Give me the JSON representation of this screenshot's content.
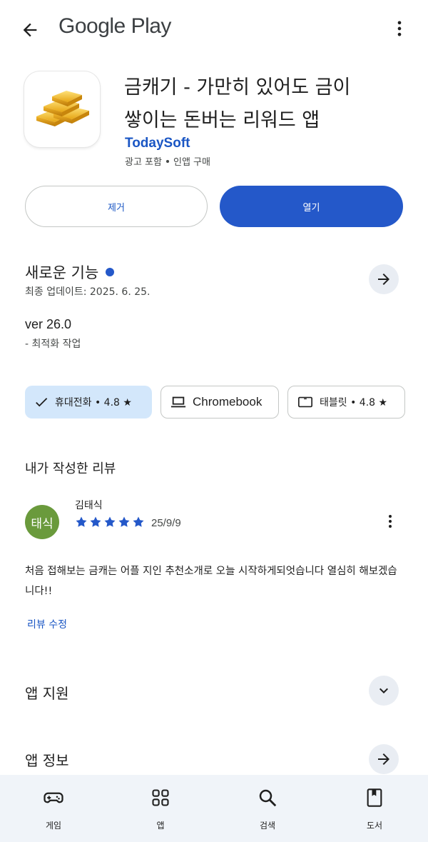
{
  "header": {
    "brand": "Google Play",
    "back_icon": "arrow-back-icon",
    "more_icon": "more-vert-icon"
  },
  "app": {
    "title_line1": "금캐기 - 가만히 있어도 금이",
    "title_line2": "쌓이는 돈버는 리워드 앱",
    "developer": "TodaySoft",
    "meta_ads": "광고 포함",
    "meta_iap": "인앱 구매",
    "icon": "gold-bars-icon"
  },
  "actions": {
    "remove_label": "제거",
    "open_label": "열기"
  },
  "whats_new": {
    "title": "새로운 기능",
    "updated": "최종 업데이트: 2025. 6. 25.",
    "version": "ver 26.0",
    "note": "- 최적화 작업"
  },
  "devices": {
    "phone_label": "휴대전화 • 4.8 ★",
    "chromebook_label": "Chromebook",
    "tablet_label": "태블릿 • 4.8 ★"
  },
  "my_review": {
    "title": "내가 작성한 리뷰",
    "avatar_text": "태식",
    "reviewer": "김태식",
    "rating": 5,
    "date": "25/9/9",
    "text": "처음 접해보는 금캐는 어플 지인 추천소개로 오늘 시작하게되엇습니다 열심히 해보겠습니다!!",
    "edit_label": "리뷰 수정"
  },
  "sections": {
    "support": "앱 지원",
    "info": "앱 정보"
  },
  "bottom_nav": {
    "games": "게임",
    "apps": "앱",
    "search": "검색",
    "books": "도서"
  },
  "colors": {
    "accent": "#2458c9",
    "chip_selected": "#d3e7fb",
    "avatar": "#6a9a3c",
    "nav_bg": "#f0f4f9"
  }
}
